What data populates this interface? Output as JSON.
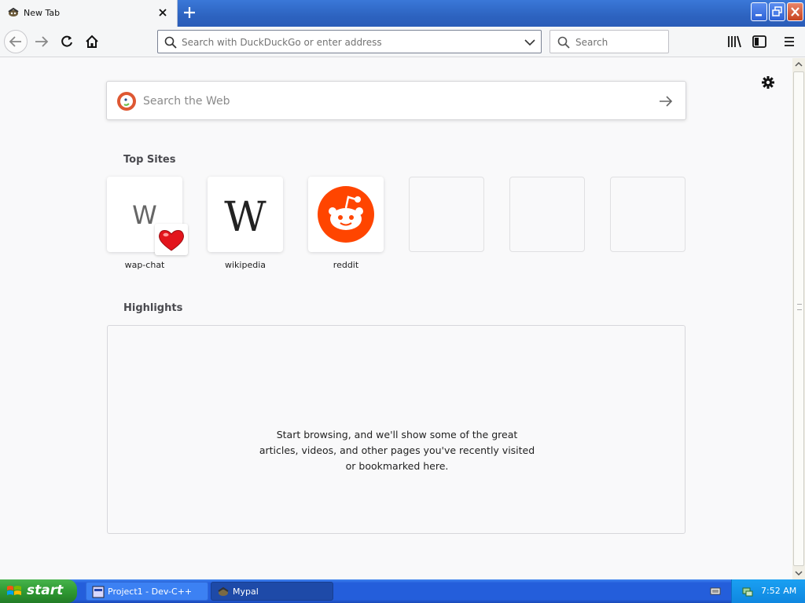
{
  "window": {
    "tab_title": "New Tab"
  },
  "navbar": {
    "url_placeholder": "Search with DuckDuckGo or enter address",
    "search_placeholder": "Search"
  },
  "newtab": {
    "websearch_placeholder": "Search the Web",
    "top_sites_title": "Top Sites",
    "top_sites": [
      {
        "label": "wap-chat",
        "tile_text": "W",
        "badge": "heart-icon"
      },
      {
        "label": "wikipedia",
        "tile_text": "W"
      },
      {
        "label": "reddit",
        "icon": "reddit-logo"
      },
      {
        "label": ""
      },
      {
        "label": ""
      },
      {
        "label": ""
      }
    ],
    "highlights_title": "Highlights",
    "highlights_message": "Start browsing, and we'll show some of the great articles, videos, and other pages you've recently visited or bookmarked here."
  },
  "taskbar": {
    "start_label": "start",
    "tasks": [
      {
        "label": "Project1 - Dev-C++",
        "active": false
      },
      {
        "label": "Mypal",
        "active": true
      }
    ],
    "clock": "7:52 AM"
  },
  "colors": {
    "reddit": "#ff4500",
    "taskbar": "#245edb",
    "start": "#2f9a33"
  }
}
